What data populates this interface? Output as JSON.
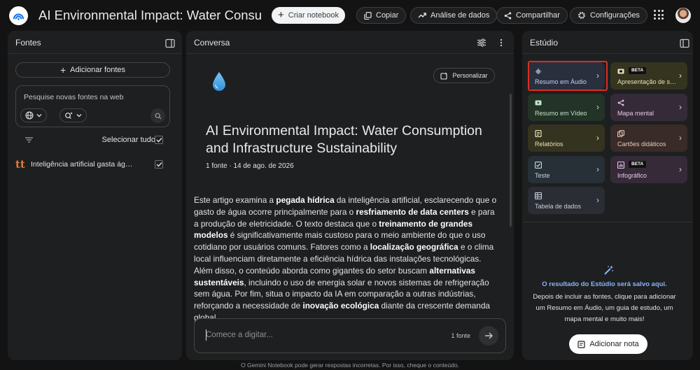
{
  "header": {
    "title": "AI Environmental Impact: Water Consumption and Infrastructure Sustainability",
    "create_label": "Criar notebook",
    "copy_label": "Copiar",
    "analysis_label": "Análise de dados",
    "share_label": "Compartilhar",
    "settings_label": "Configurações"
  },
  "sources": {
    "title": "Fontes",
    "add_label": "Adicionar fontes",
    "search_placeholder": "Pesquise novas fontes na web",
    "select_all": "Selecionar tudo",
    "items": [
      {
        "title": "Inteligência artificial gasta água..."
      }
    ]
  },
  "chat": {
    "title": "Conversa",
    "personalize_label": "Personalizar",
    "notebook_title": "AI Environmental Impact: Water Consumption and Infrastructure Sustainability",
    "meta": "1 fonte · 14 de ago. de 2026",
    "summary": [
      {
        "text": "Este artigo examina a "
      },
      {
        "text": "pegada hídrica",
        "bold": true
      },
      {
        "text": " da inteligência artificial, esclarecendo que o gasto de água ocorre principalmente para o "
      },
      {
        "text": "resfriamento de data centers",
        "bold": true
      },
      {
        "text": " e para a produção de eletricidade. O texto destaca que o "
      },
      {
        "text": "treinamento de grandes modelos",
        "bold": true
      },
      {
        "text": " é significativamente mais custoso para o meio ambiente do que o uso cotidiano por usuários comuns. Fatores como a "
      },
      {
        "text": "localização geográfica",
        "bold": true
      },
      {
        "text": " e o clima local influenciam diretamente a eficiência hídrica das instalações tecnológicas. Além disso, o conteúdo aborda como gigantes do setor buscam "
      },
      {
        "text": "alternativas sustentáveis",
        "bold": true
      },
      {
        "text": ", incluindo o uso de energia solar e novos sistemas de refrigeração sem água. Por fim, situa o impacto da IA em comparação a outras indústrias, reforçando a necessidade de "
      },
      {
        "text": "inovação ecológica",
        "bold": true
      },
      {
        "text": " diante da crescente demanda global."
      }
    ],
    "input_placeholder": "Comece a digitar...",
    "source_count": "1 fonte"
  },
  "studio": {
    "title": "Estúdio",
    "tiles": [
      {
        "label": "Resumo em Áudio",
        "icon": "audio-waves-icon",
        "bg": "#2a2f3e",
        "fg": "#c2d2f2"
      },
      {
        "label": "Apresentação de slides",
        "icon": "slides-icon",
        "bg": "#35341f",
        "fg": "#e8e3b8",
        "beta": "BETA"
      },
      {
        "label": "Resumo em Vídeo",
        "icon": "video-icon",
        "bg": "#233327",
        "fg": "#bfe3c6"
      },
      {
        "label": "Mapa mental",
        "icon": "mind-map-icon",
        "bg": "#352b38",
        "fg": "#e6c8ea"
      },
      {
        "label": "Relatórios",
        "icon": "reports-icon",
        "bg": "#34331f",
        "fg": "#e9e3b5"
      },
      {
        "label": "Cartões didáticos",
        "icon": "flashcards-icon",
        "bg": "#382b28",
        "fg": "#ecc9bf"
      },
      {
        "label": "Teste",
        "icon": "quiz-icon",
        "bg": "#273036",
        "fg": "#bfd6e4"
      },
      {
        "label": "Infográfico",
        "icon": "infographic-icon",
        "bg": "#362a38",
        "fg": "#e7c6ea",
        "beta": "BETA"
      },
      {
        "label": "Tabela de dados",
        "icon": "data-table-icon",
        "bg": "#2a2d33",
        "fg": "#c8d0de"
      }
    ],
    "output_title": "O resultado do Estúdio será salvo aqui.",
    "output_desc": "Depois de incluir as fontes, clique para adicionar um Resumo em Áudio, um guia de estudo, um mapa mental e muito mais!",
    "add_note_label": "Adicionar nota"
  },
  "footer": "O Gemini Notebook pode gerar respostas incorretas. Por isso, cheque o conteúdo."
}
